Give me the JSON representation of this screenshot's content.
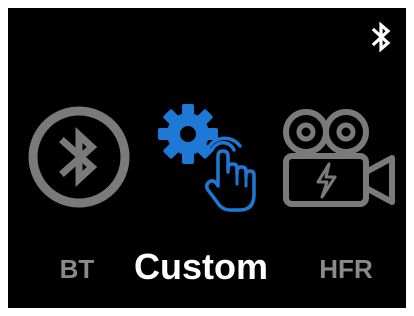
{
  "status_bar": {
    "icon": "bluetooth-icon",
    "color": "#ffffff"
  },
  "modes": [
    {
      "id": "bt",
      "label": "BT",
      "icon": "bluetooth-circle-icon",
      "selected": false,
      "color": "#7a7a7a"
    },
    {
      "id": "custom",
      "label": "Custom",
      "icon": "gear-tap-icon",
      "selected": true,
      "color": "#1e78d6"
    },
    {
      "id": "hfr",
      "label": "HFR",
      "icon": "video-camera-flash-icon",
      "selected": false,
      "color": "#7a7a7a"
    }
  ],
  "colors": {
    "background": "#000000",
    "selected_label": "#ffffff",
    "unselected_label": "#8a8a8a",
    "accent": "#1e78d6",
    "inactive_icon": "#7a7a7a"
  }
}
